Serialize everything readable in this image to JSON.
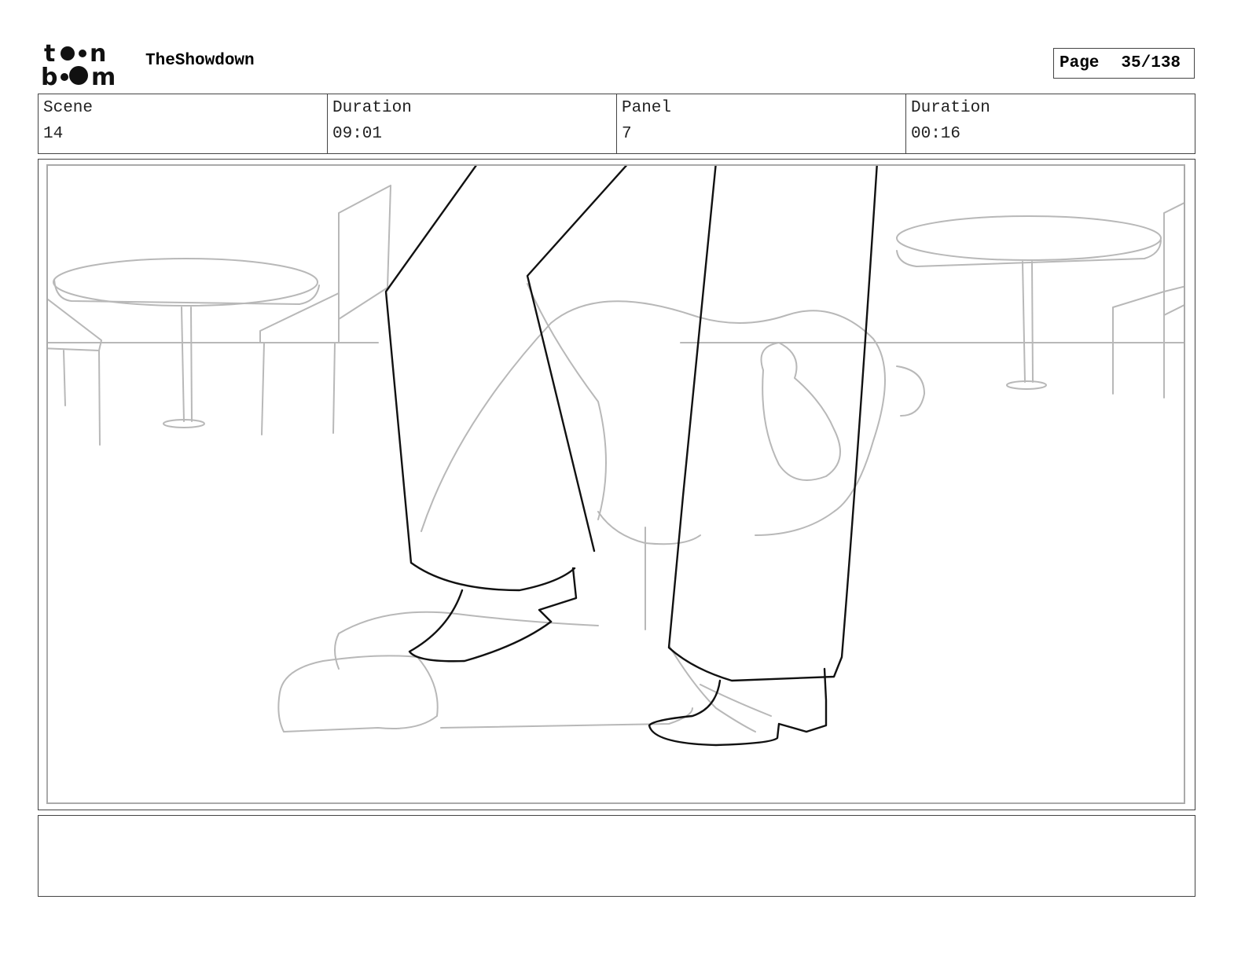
{
  "header": {
    "logo_text": "toon boom",
    "project_title": "TheShowdown",
    "page_label": "Page",
    "page_number": "35/138"
  },
  "info": {
    "scene_label": "Scene",
    "scene_value": "14",
    "scene_duration_label": "Duration",
    "scene_duration_value": "09:01",
    "panel_label": "Panel",
    "panel_value": "7",
    "panel_duration_label": "Duration",
    "panel_duration_value": "00:16"
  },
  "panel": {
    "image_description": "rough storyboard sketch: a standing character's legs in the foreground, a crouching figure on the floor behind, cafe tables and chairs in the background"
  },
  "notes": {
    "text": ""
  }
}
